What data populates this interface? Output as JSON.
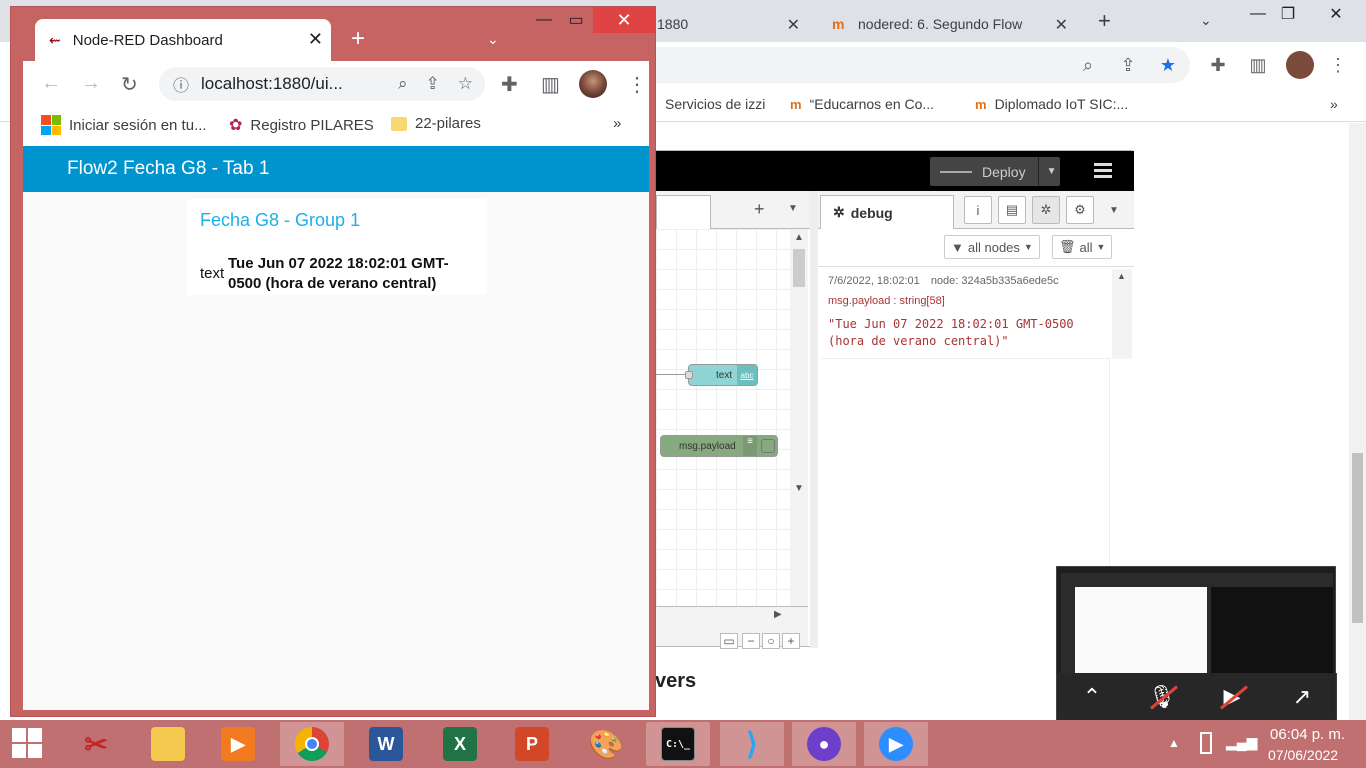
{
  "background_browser": {
    "tabs": [
      {
        "title": "1880"
      },
      {
        "title": "nodered: 6. Segundo Flow"
      }
    ],
    "bookmarks": [
      {
        "label": "Servicios de izzi"
      },
      {
        "label": "“Educarnos en  Co..."
      },
      {
        "label": "Diplomado IoT SIC:..."
      }
    ],
    "page_heading_fragment": "vers"
  },
  "node_red_editor": {
    "deploy_label": "Deploy",
    "nodes": [
      {
        "label": "text",
        "icon": "abc"
      },
      {
        "label": "msg.payload"
      }
    ],
    "sidebar": {
      "tab_label": "debug",
      "filter_nodes": "all nodes",
      "filter_clear": "all",
      "message": {
        "timestamp": "7/6/2022, 18:02:01",
        "node": "node: 324a5b335a6ede5c",
        "type": "msg.payload : string[58]",
        "value": "\"Tue Jun 07 2022 18:02:01 GMT-0500 (hora de verano central)\""
      }
    }
  },
  "foreground_browser": {
    "tab_title": "Node-RED Dashboard",
    "url": "localhost:1880/ui...",
    "bookmarks": [
      {
        "label": "Iniciar sesión en tu..."
      },
      {
        "label": "Registro PILARES"
      },
      {
        "label": "22-pilares"
      }
    ],
    "more_bookmarks": "»"
  },
  "dashboard": {
    "header_title": "Flow2 Fecha G8 - Tab 1",
    "group_title": "Fecha G8 - Group 1",
    "text_label": "text",
    "text_value": "Tue Jun 07 2022 18:02:01 GMT-0500 (hora de verano central)"
  },
  "taskbar": {
    "time": "06:04 p. m.",
    "date": "07/06/2022"
  },
  "colors": {
    "dashboard_header": "#0094ce",
    "group_title": "#1bb0e8",
    "window_frame": "#c66464",
    "taskbar": "#c07070"
  }
}
